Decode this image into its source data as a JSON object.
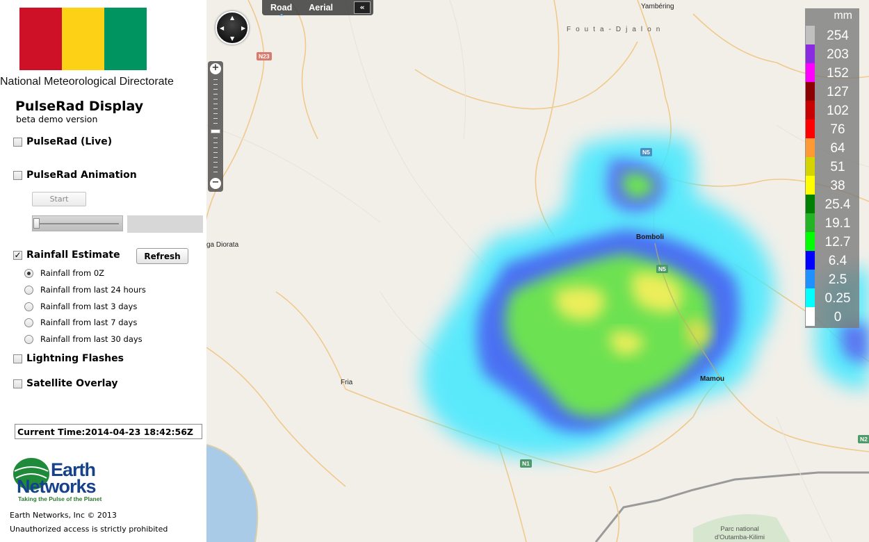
{
  "panel": {
    "org_name": "National Meteorological Directorate",
    "flag_colors": [
      "#ce1126",
      "#fcd116",
      "#009460"
    ],
    "app_title": "PulseRad Display",
    "app_subtitle": "beta demo version",
    "layers": {
      "live": {
        "label": "PulseRad (Live)",
        "checked": false
      },
      "animation": {
        "label": "PulseRad Animation",
        "checked": false,
        "start_label": "Start"
      },
      "rainfall": {
        "label": "Rainfall Estimate",
        "checked": true,
        "refresh_label": "Refresh"
      },
      "lightning": {
        "label": "Lightning Flashes",
        "checked": false
      },
      "satellite": {
        "label": "Satellite Overlay",
        "checked": false
      }
    },
    "rainfall_options": [
      {
        "label": "Rainfall from 0Z",
        "selected": true
      },
      {
        "label": "Rainfall from last 24 hours",
        "selected": false
      },
      {
        "label": "Rainfall from last 3 days",
        "selected": false
      },
      {
        "label": "Rainfall from last 7 days",
        "selected": false
      },
      {
        "label": "Rainfall from last 30 days",
        "selected": false
      }
    ],
    "current_time": "Current Time:2014-04-23 18:42:56Z",
    "logo": {
      "line1": "Earth",
      "line2": "Networks",
      "tagline": "Taking the Pulse of the Planet"
    },
    "footer": {
      "copyright": "Earth Networks, Inc © 2013",
      "notice": "Unauthorized access is strictly prohibited"
    }
  },
  "map": {
    "type_tabs": [
      {
        "label": "Road",
        "selected": true
      },
      {
        "label": "Aerial",
        "selected": false
      }
    ],
    "collapse_label": "«",
    "places": {
      "yambering": "Yambéring",
      "fouta": "Fouta-Djalon",
      "diorata": "ga Diorata",
      "bomboli": "Bomboli",
      "fria": "Fria",
      "mamou": "Mamou",
      "park": "Parc national d'Outamba-Kilimi"
    },
    "roads": {
      "n23": "N23",
      "n5a": "N5",
      "n5b": "N5",
      "n1": "N1",
      "n2": "N2"
    }
  },
  "legend": {
    "unit": "mm",
    "levels": [
      {
        "value": "254",
        "color": "#c0c0c0"
      },
      {
        "value": "203",
        "color": "#8a2be2"
      },
      {
        "value": "152",
        "color": "#ff00ff"
      },
      {
        "value": "127",
        "color": "#8b0000"
      },
      {
        "value": "102",
        "color": "#c80000"
      },
      {
        "value": "76",
        "color": "#ff0000"
      },
      {
        "value": "64",
        "color": "#ff9933"
      },
      {
        "value": "51",
        "color": "#d4d400"
      },
      {
        "value": "38",
        "color": "#ffff00"
      },
      {
        "value": "25.4",
        "color": "#008000"
      },
      {
        "value": "19.1",
        "color": "#22b422"
      },
      {
        "value": "12.7",
        "color": "#00ff00"
      },
      {
        "value": "6.4",
        "color": "#0000ff"
      },
      {
        "value": "2.5",
        "color": "#1e90ff"
      },
      {
        "value": "0.25",
        "color": "#00ffff"
      },
      {
        "value": "0",
        "color": "#ffffff"
      }
    ]
  }
}
